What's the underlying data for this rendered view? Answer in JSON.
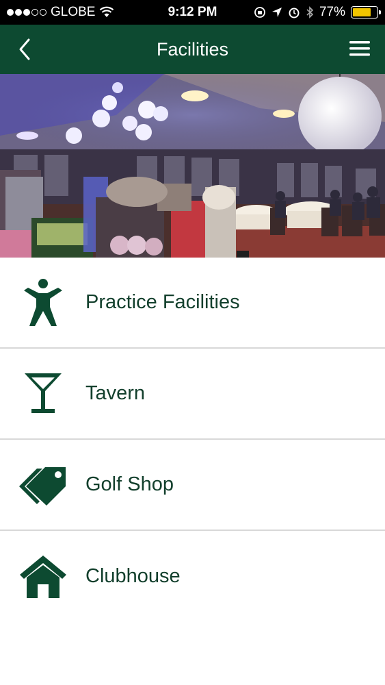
{
  "status_bar": {
    "carrier": "GLOBE",
    "time": "9:12 PM",
    "battery": "77%",
    "battery_level": 0.77,
    "signal_bars_filled": 3,
    "signal_bars_total": 5
  },
  "nav": {
    "title": "Facilities",
    "back_icon": "chevron-left-icon",
    "menu_icon": "hamburger-menu-icon"
  },
  "colors": {
    "brand": "#0d4a31",
    "text": "#123f2c",
    "divider": "#d8d8d8"
  },
  "facilities": [
    {
      "label": "Practice Facilities",
      "icon": "person-icon"
    },
    {
      "label": "Tavern",
      "icon": "cocktail-glass-icon"
    },
    {
      "label": "Golf Shop",
      "icon": "price-tag-icon"
    },
    {
      "label": "Clubhouse",
      "icon": "house-icon"
    }
  ]
}
